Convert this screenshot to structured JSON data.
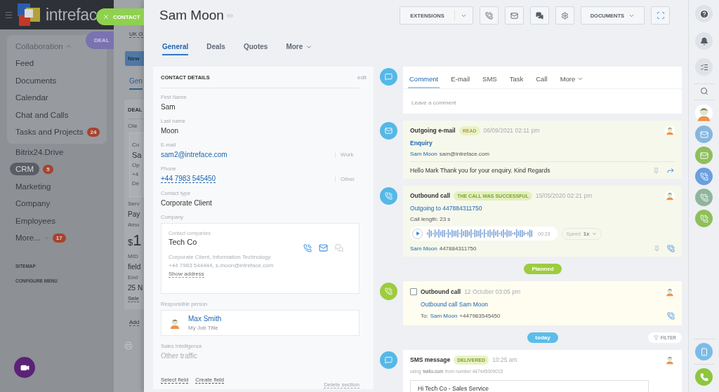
{
  "underlay": {
    "logo": "intrefac",
    "sidebar": {
      "group": {
        "label": "Collaboration",
        "expanded": true,
        "children": [
          {
            "label": "Feed",
            "selected": false
          },
          {
            "label": "Documents",
            "selected": false
          },
          {
            "label": "Calendar",
            "selected": false
          },
          {
            "label": "Chat and Calls",
            "selected": false
          },
          {
            "label": "Tasks and Projects",
            "badge": "24",
            "selected": false
          }
        ]
      },
      "items": [
        {
          "label": "Bitrix24.Drive",
          "selected": false,
          "dropdown": false
        },
        {
          "label": "CRM",
          "badge": "5",
          "selected": true,
          "dropdown": false
        },
        {
          "label": "Marketing",
          "selected": false,
          "dropdown": false
        },
        {
          "label": "Company",
          "selected": false,
          "dropdown": false
        },
        {
          "label": "Employees",
          "selected": false,
          "dropdown": false
        },
        {
          "label": "More...",
          "badge": "17",
          "selected": false,
          "dropdown": true
        }
      ],
      "links": [
        "SITEMAP",
        "CONFIGURE MENU"
      ]
    },
    "page": {
      "top_link": "UK O",
      "button": "New",
      "tab": "Gen",
      "card": {
        "title": "DEAL",
        "rows": [
          {
            "kind": "label",
            "text": "Clie"
          },
          {
            "kind": "box",
            "lines": [
              {
                "kind": "label",
                "text": "Co"
              },
              {
                "kind": "name",
                "text": "Sa"
              },
              {
                "kind": "label",
                "text": "Op"
              },
              {
                "kind": "label",
                "text": "+4"
              },
              {
                "kind": "label",
                "text": "De"
              }
            ]
          },
          {
            "kind": "label",
            "text": "Serv"
          },
          {
            "kind": "value",
            "text": "Pay"
          },
          {
            "kind": "label",
            "text": "Amo"
          },
          {
            "kind": "amount",
            "currency": "$",
            "text": "1"
          },
          {
            "kind": "label",
            "text": "MID"
          },
          {
            "kind": "value",
            "text": "field"
          },
          {
            "kind": "label",
            "text": "End"
          },
          {
            "kind": "value",
            "text": "25 N"
          },
          {
            "kind": "link",
            "text": "Sele"
          }
        ]
      },
      "footer_link": "Add"
    }
  },
  "slider_tabs": [
    {
      "kind": "contact",
      "label": "CONTACT"
    },
    {
      "kind": "deal",
      "label": "DEAL"
    }
  ],
  "header": {
    "title": "Sam Moon",
    "extensions": "EXTENSIONS",
    "documents": "DOCUMENTS"
  },
  "tabs": [
    {
      "label": "General",
      "selected": true,
      "dropdown": false
    },
    {
      "label": "Deals",
      "selected": false,
      "dropdown": false
    },
    {
      "label": "Quotes",
      "selected": false,
      "dropdown": false
    },
    {
      "label": "More",
      "selected": false,
      "dropdown": true
    }
  ],
  "contact_details": {
    "title": "CONTACT DETAILS",
    "edit": "edit",
    "fields": [
      {
        "kind": "text",
        "label": "First Name",
        "value": "Sam"
      },
      {
        "kind": "text",
        "label": "Last name",
        "value": "Moon"
      },
      {
        "kind": "email",
        "label": "E-mail",
        "value": "sam2@intreface.com",
        "type": "Work"
      },
      {
        "kind": "phone",
        "label": "Phone",
        "value": "+44 7983 545450",
        "type": "Other"
      },
      {
        "kind": "text",
        "label": "Contact type",
        "value": "Corporate Client"
      },
      {
        "kind": "company",
        "label": "Company",
        "caption": "Contact companies",
        "name": "Tech Co",
        "details": [
          "Corporate Client, Information Technology",
          "+44 7983 544444, s.moon@intreface.com"
        ],
        "link": "Show address"
      },
      {
        "kind": "person",
        "label": "Responsible person",
        "name": "Max Smith",
        "title": "My Job Title"
      },
      {
        "kind": "muted",
        "label": "Sales Intelligence",
        "value": "Other traffic"
      }
    ],
    "actions": [
      "Select field",
      "Create field"
    ],
    "delete": "Delete section"
  },
  "timeline": [
    {
      "kind": "composer",
      "tabs": [
        {
          "label": "Comment",
          "selected": true,
          "dropdown": false
        },
        {
          "label": "E-mail",
          "selected": false,
          "dropdown": false
        },
        {
          "label": "SMS",
          "selected": false,
          "dropdown": false
        },
        {
          "label": "Task",
          "selected": false,
          "dropdown": false
        },
        {
          "label": "Call",
          "selected": false,
          "dropdown": false
        },
        {
          "label": "More",
          "selected": false,
          "dropdown": true
        }
      ],
      "placeholder": "Leave a comment"
    },
    {
      "kind": "email",
      "title": "Outgoing e-mail",
      "badge": "READ",
      "time": "06/09/2021 02:11 pm",
      "subject": "Enquiry",
      "from_name": "Sam Moon",
      "from_address": "sam@intreface.com",
      "body": "Hello Mark Thank you for your enquiry. Kind Regards"
    },
    {
      "kind": "call",
      "title": "Outbound call",
      "badge": "THE CALL WAS SUCCESSFUL",
      "time": "15/05/2020 02:21 pm",
      "link": "Outgoing to 447884311750",
      "length": "Call length: 23 s",
      "duration": "00:23",
      "speed_label": "Speed",
      "speed": "1x",
      "contact_name": "Sam Moon",
      "contact_number": "447884311750"
    },
    {
      "kind": "divider",
      "label": "Planned",
      "color": "#9dcc3e"
    },
    {
      "kind": "planned_call",
      "checked": false,
      "title": "Outbound call",
      "time": "12 October 03:05 pm",
      "link": "Outbound call Sam Moon",
      "to_label": "To:",
      "to_name": "Sam Moon",
      "to_number": "+447983545450"
    },
    {
      "kind": "divider",
      "label": "today",
      "color": "#5bbdea",
      "filter": "FILTER"
    },
    {
      "kind": "sms",
      "title": "SMS message",
      "badge": "DELIVERED",
      "time": "10:25 am",
      "using": "using",
      "service": "twilio.com",
      "from_text": "from number 447445009015",
      "message": "Hi Tech Co - Sales Service"
    }
  ]
}
